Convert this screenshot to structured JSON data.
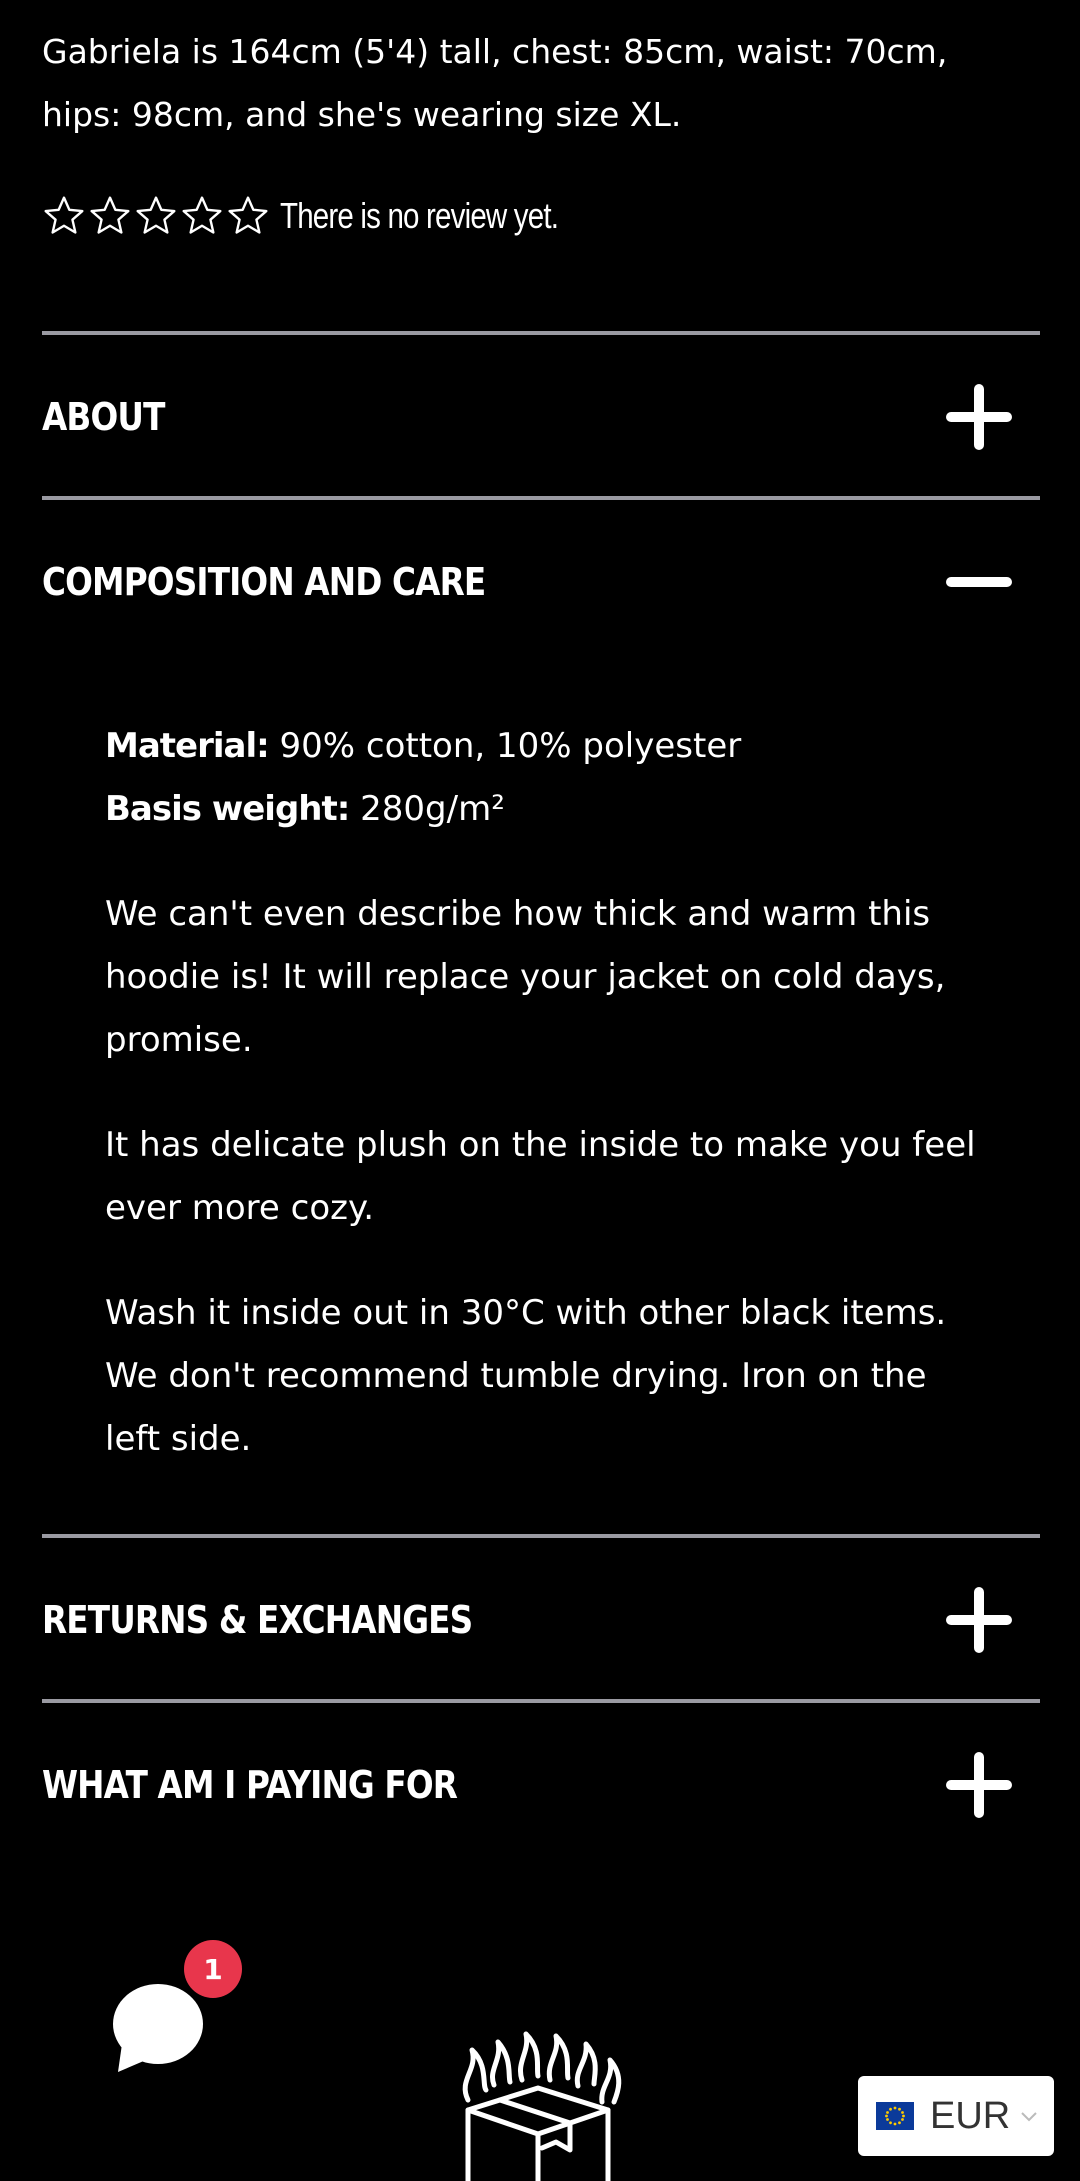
{
  "product": {
    "model_info": "Gabriela is 164cm (5'4) tall, chest: 85cm, waist: 70cm, hips: 98cm, and she's wearing size XL.",
    "rating_stars": 0,
    "rating_max": 5,
    "review_text": "There is no review yet."
  },
  "accordion": [
    {
      "title": "ABOUT",
      "icon": "plus-icon",
      "expanded": false
    },
    {
      "title": "COMPOSITION AND CARE",
      "icon": "minus-icon",
      "expanded": true
    },
    {
      "title": "RETURNS & EXCHANGES",
      "icon": "plus-icon",
      "expanded": false
    },
    {
      "title": "WHAT AM I PAYING FOR",
      "icon": "plus-icon",
      "expanded": false
    }
  ],
  "composition": {
    "material_label": "Material:",
    "material_value": " 90% cotton, 10% polyester",
    "weight_label": "Basis weight:",
    "weight_value": " 280g/m²",
    "paragraphs": [
      "We can't even describe how thick and warm this hoodie is! It will replace your jacket on cold days, promise.",
      "It has delicate plush on the inside to make you feel ever more cozy.",
      "Wash it inside out in 30°C with other black items. We don't recommend tumble drying. Iron on the left side."
    ]
  },
  "chat": {
    "icon": "chat-bubble-icon",
    "badge_count": "1",
    "badge_color": "#e8364c"
  },
  "footer_logo": {
    "icon": "burning-box-logo"
  },
  "currency": {
    "code": "EUR",
    "flag": "eu-flag-icon",
    "icon": "chevron-down-icon"
  },
  "colors": {
    "background": "#000000",
    "text": "#ffffff",
    "divider": "#9a9aa2"
  }
}
